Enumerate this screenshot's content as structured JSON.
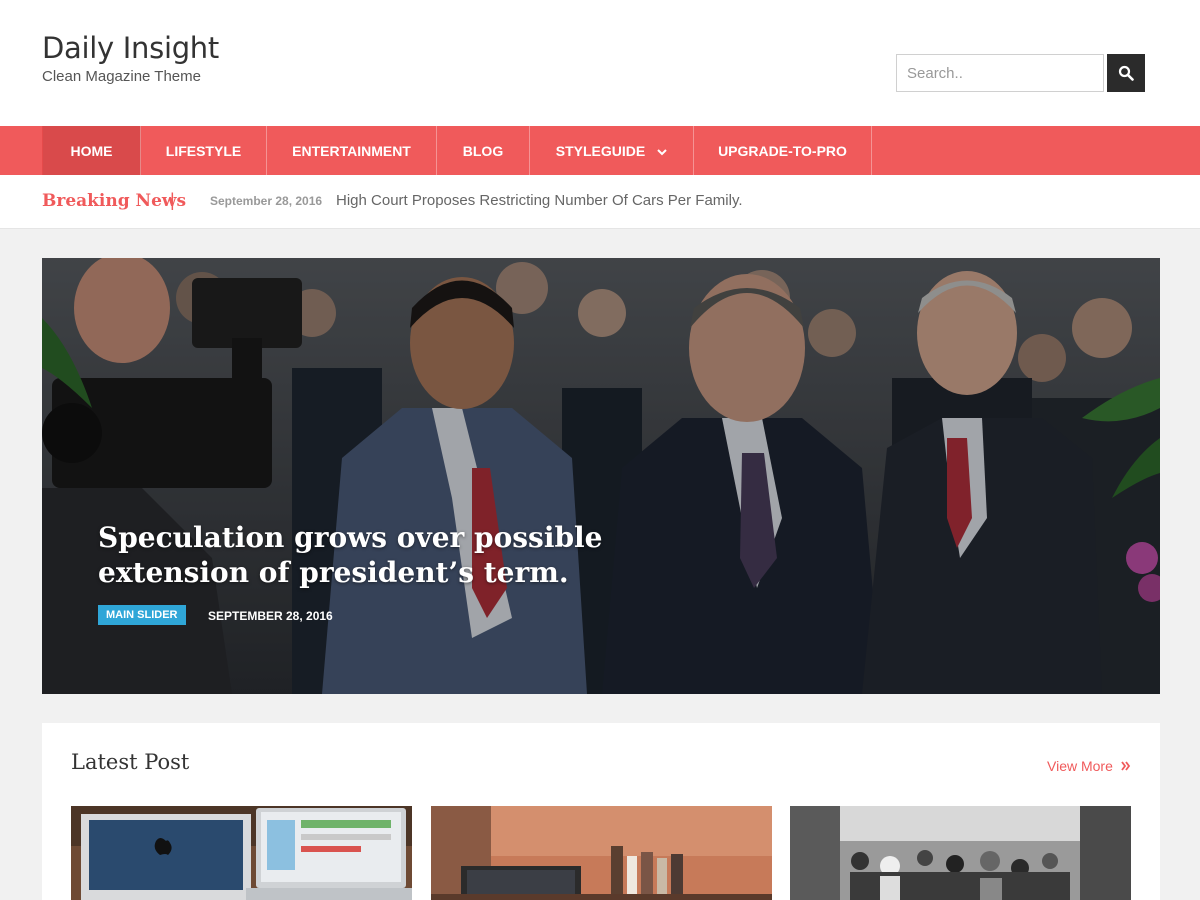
{
  "site": {
    "title": "Daily Insight",
    "tagline": "Clean Magazine Theme"
  },
  "search": {
    "placeholder": "Search..",
    "icon": "search-icon"
  },
  "nav": {
    "items": [
      {
        "label": "HOME",
        "active": true
      },
      {
        "label": "LIFESTYLE",
        "active": false
      },
      {
        "label": "ENTERTAINMENT",
        "active": false
      },
      {
        "label": "BLOG",
        "active": false
      },
      {
        "label": "STYLEGUIDE",
        "active": false,
        "has_dropdown": true
      },
      {
        "label": "UPGRADE-TO-PRO",
        "active": false
      }
    ]
  },
  "breaking": {
    "label": "Breaking News",
    "separator": "|",
    "date": "September 28, 2016",
    "headline": "High Court Proposes Restricting Number Of Cars Per Family."
  },
  "slider": {
    "title": "Speculation grows over possible extension of president’s term.",
    "category": "MAIN SLIDER",
    "date": "SEPTEMBER 28, 2016"
  },
  "latest": {
    "title": "Latest Post",
    "view_more": "View More",
    "view_more_icon": "double-chevron-right-icon"
  },
  "colors": {
    "accent": "#f05a5b",
    "nav_active": "#d94a4b",
    "category_badge": "#2fa6d8",
    "search_button": "#2b2b2b"
  }
}
